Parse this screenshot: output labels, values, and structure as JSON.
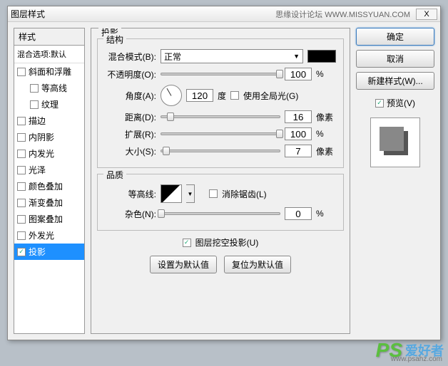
{
  "titlebar": {
    "title": "图层样式",
    "right_text": "思缘设计论坛  WWW.MISSYUAN.COM",
    "close": "X"
  },
  "left": {
    "header": "样式",
    "subheader": "混合选项:默认",
    "items": [
      {
        "label": "斜面和浮雕",
        "checked": false
      },
      {
        "label": "等高线",
        "checked": false,
        "indent": true
      },
      {
        "label": "纹理",
        "checked": false,
        "indent": true
      },
      {
        "label": "描边",
        "checked": false
      },
      {
        "label": "内阴影",
        "checked": false
      },
      {
        "label": "内发光",
        "checked": false
      },
      {
        "label": "光泽",
        "checked": false
      },
      {
        "label": "颜色叠加",
        "checked": false
      },
      {
        "label": "渐变叠加",
        "checked": false
      },
      {
        "label": "图案叠加",
        "checked": false
      },
      {
        "label": "外发光",
        "checked": false
      },
      {
        "label": "投影",
        "checked": true,
        "selected": true
      }
    ]
  },
  "center": {
    "title": "投影",
    "fs1": {
      "title": "结构",
      "blend_label": "混合模式(B):",
      "blend_value": "正常",
      "opacity_label": "不透明度(O):",
      "opacity_value": "100",
      "opacity_unit": "%",
      "angle_label": "角度(A):",
      "angle_value": "120",
      "angle_unit": "度",
      "global_label": "使用全局光(G)",
      "distance_label": "距离(D):",
      "distance_value": "16",
      "distance_unit": "像素",
      "spread_label": "扩展(R):",
      "spread_value": "100",
      "spread_unit": "%",
      "size_label": "大小(S):",
      "size_value": "7",
      "size_unit": "像素"
    },
    "fs2": {
      "title": "品质",
      "contour_label": "等高线:",
      "antialias_label": "消除锯齿(L)",
      "noise_label": "杂色(N):",
      "noise_value": "0",
      "noise_unit": "%"
    },
    "knockout_label": "图层挖空投影(U)",
    "btn_default": "设置为默认值",
    "btn_reset": "复位为默认值"
  },
  "right": {
    "ok": "确定",
    "cancel": "取消",
    "new_style": "新建样式(W)...",
    "preview": "预览(V)"
  },
  "watermark": {
    "ps": "PS",
    "txt": "爱好者",
    "url": "www.psahz.com"
  }
}
